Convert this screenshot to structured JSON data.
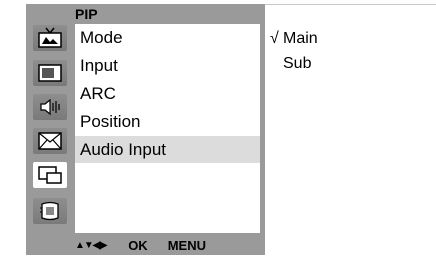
{
  "menu": {
    "title": "PIP",
    "sidebar": [
      {
        "icon": "tv-icon",
        "selected": false
      },
      {
        "icon": "screen-icon",
        "selected": false
      },
      {
        "icon": "speaker-icon",
        "selected": false
      },
      {
        "icon": "envelope-icon",
        "selected": false
      },
      {
        "icon": "pip-windows-icon",
        "selected": true
      },
      {
        "icon": "chip-icon",
        "selected": false
      }
    ],
    "items": [
      {
        "label": "Mode"
      },
      {
        "label": "Input"
      },
      {
        "label": "ARC"
      },
      {
        "label": "Position"
      },
      {
        "label": "Audio Input",
        "selected": true
      }
    ],
    "footer": {
      "arrows": "▲▼◀▶",
      "ok": "OK",
      "menu": "MENU"
    }
  },
  "submenu": {
    "options": [
      {
        "label": "Main",
        "checked": true,
        "check_mark": "√"
      },
      {
        "label": "Sub",
        "checked": false
      }
    ]
  }
}
